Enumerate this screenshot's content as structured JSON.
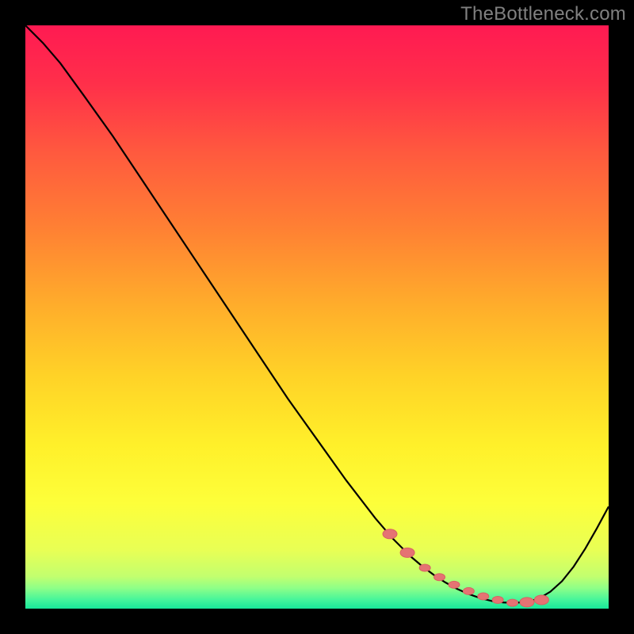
{
  "watermark": "TheBottleneck.com",
  "colors": {
    "frame_bg": "#000000",
    "curve": "#000000",
    "bead_fill": "#e57373",
    "bead_stroke": "#d86262",
    "watermark": "#808080"
  },
  "gradient_stops": [
    {
      "offset": 0.0,
      "color": "#ff1a52"
    },
    {
      "offset": 0.1,
      "color": "#ff2f4a"
    },
    {
      "offset": 0.22,
      "color": "#ff5a3e"
    },
    {
      "offset": 0.35,
      "color": "#ff8133"
    },
    {
      "offset": 0.48,
      "color": "#ffad2b"
    },
    {
      "offset": 0.6,
      "color": "#ffd227"
    },
    {
      "offset": 0.72,
      "color": "#fff02a"
    },
    {
      "offset": 0.82,
      "color": "#fdff3a"
    },
    {
      "offset": 0.9,
      "color": "#e8ff55"
    },
    {
      "offset": 0.945,
      "color": "#c2ff6f"
    },
    {
      "offset": 0.965,
      "color": "#8dff88"
    },
    {
      "offset": 0.985,
      "color": "#45f59b"
    },
    {
      "offset": 1.0,
      "color": "#18e89a"
    }
  ],
  "chart_data": {
    "type": "line",
    "title": "",
    "xlabel": "",
    "ylabel": "",
    "xlim": [
      0,
      100
    ],
    "ylim": [
      0,
      100
    ],
    "grid": false,
    "legend": false,
    "series": [
      {
        "name": "curve",
        "x": [
          0,
          3,
          6,
          10,
          15,
          20,
          25,
          30,
          35,
          40,
          45,
          50,
          55,
          60,
          63,
          66,
          68,
          70,
          72,
          74,
          76,
          78,
          80,
          82,
          84,
          86,
          88,
          90,
          92,
          94,
          96,
          98,
          100
        ],
        "y": [
          100,
          97,
          93.5,
          88,
          81,
          73.5,
          66,
          58.5,
          51,
          43.5,
          36,
          29,
          22,
          15.5,
          12,
          9,
          7.3,
          5.8,
          4.5,
          3.4,
          2.5,
          1.8,
          1.3,
          1.05,
          1.0,
          1.15,
          1.7,
          2.9,
          4.7,
          7.2,
          10.3,
          13.8,
          17.5
        ]
      }
    ],
    "markers": {
      "name": "sweet-spot",
      "shape": "pill",
      "x": [
        62.5,
        65.5,
        68.5,
        71,
        73.5,
        76,
        78.5,
        81,
        83.5,
        86,
        88.5
      ],
      "y": [
        12.8,
        9.6,
        7.0,
        5.4,
        4.1,
        3.0,
        2.1,
        1.5,
        1.0,
        1.1,
        1.5
      ]
    }
  }
}
